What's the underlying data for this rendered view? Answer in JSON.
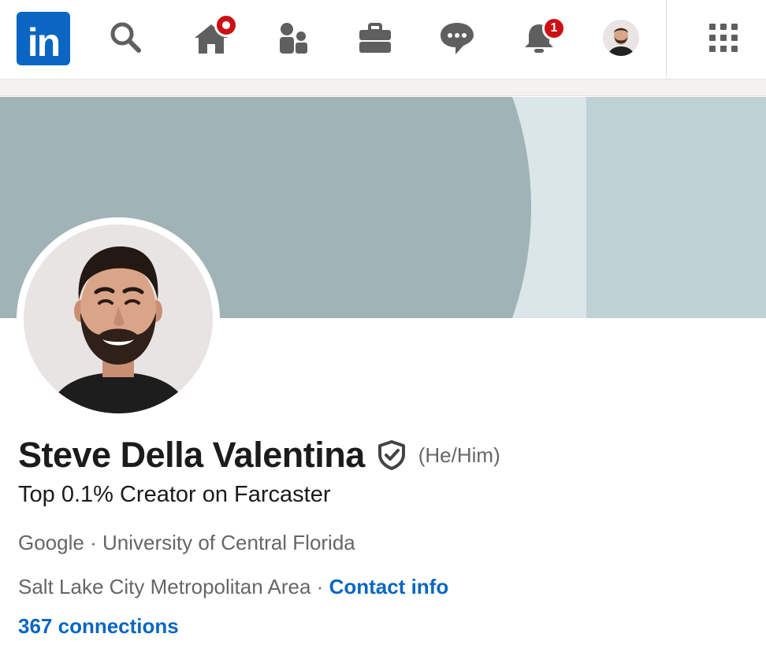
{
  "nav": {
    "logo_text": "in",
    "items": [
      {
        "name": "search-icon"
      },
      {
        "name": "home-icon",
        "badge": "dot"
      },
      {
        "name": "my-network-icon"
      },
      {
        "name": "jobs-briefcase-icon"
      },
      {
        "name": "messaging-icon"
      },
      {
        "name": "notifications-bell-icon",
        "badge": "1"
      },
      {
        "name": "me-avatar"
      },
      {
        "name": "apps-grid-icon"
      }
    ],
    "notifications_badge": "1",
    "colors": {
      "brand": "#0a66c2",
      "badge": "#cc1016",
      "icon": "#5f5f5f"
    }
  },
  "banner": {
    "colors": {
      "left": "#a0b3b6",
      "mid": "#dbe6e8",
      "right": "#bed1d4"
    }
  },
  "profile": {
    "name": "Steve Della Valentina",
    "verified_icon": "shield-check-icon",
    "pronouns": "(He/Him)",
    "headline": "Top 0.1% Creator on Farcaster",
    "company": "Google",
    "separator": "·",
    "school": "University of Central Florida",
    "location": "Salt Lake City Metropolitan Area",
    "contact_info": "Contact info",
    "connections": "367 connections"
  }
}
